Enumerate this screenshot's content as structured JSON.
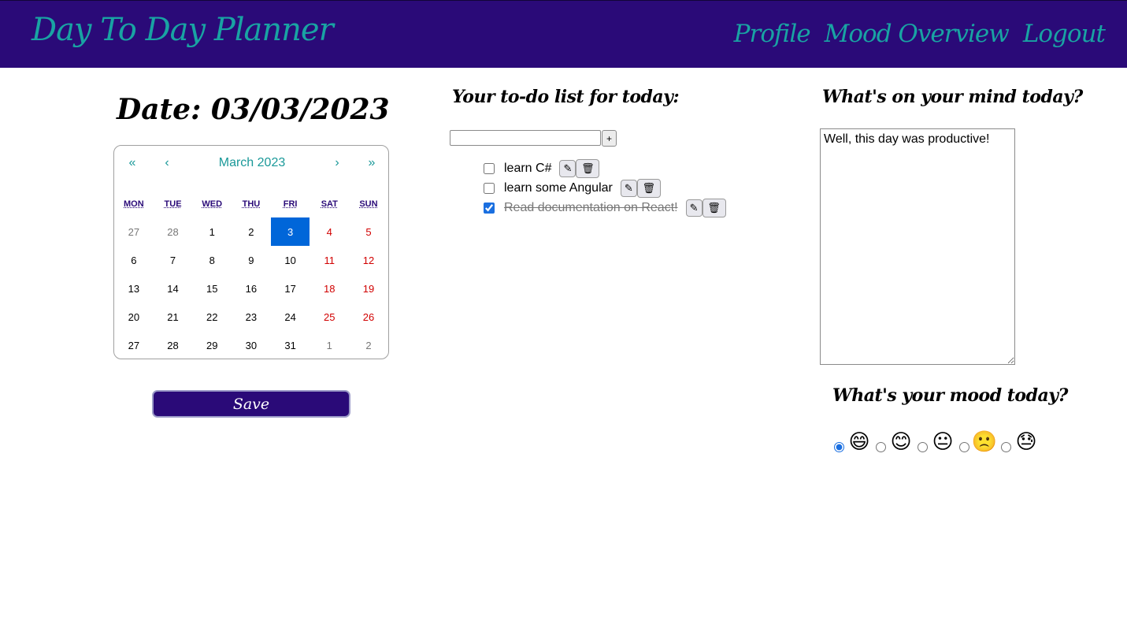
{
  "header": {
    "brand": "Day To Day Planner",
    "nav": [
      "Profile",
      "Mood Overview",
      "Logout"
    ]
  },
  "date_title": "Date: 03/03/2023",
  "calendar": {
    "month_label": "March 2023",
    "prev_year": "«",
    "prev_month": "‹",
    "next_month": "›",
    "next_year": "»",
    "weekdays": [
      "MON",
      "TUE",
      "WED",
      "THU",
      "FRI",
      "SAT",
      "SUN"
    ],
    "days": [
      {
        "d": "27",
        "type": "other"
      },
      {
        "d": "28",
        "type": "other"
      },
      {
        "d": "1",
        "type": "normal"
      },
      {
        "d": "2",
        "type": "normal"
      },
      {
        "d": "3",
        "type": "selected"
      },
      {
        "d": "4",
        "type": "weekend"
      },
      {
        "d": "5",
        "type": "weekend"
      },
      {
        "d": "6",
        "type": "normal"
      },
      {
        "d": "7",
        "type": "normal"
      },
      {
        "d": "8",
        "type": "normal"
      },
      {
        "d": "9",
        "type": "normal"
      },
      {
        "d": "10",
        "type": "normal"
      },
      {
        "d": "11",
        "type": "weekend"
      },
      {
        "d": "12",
        "type": "weekend"
      },
      {
        "d": "13",
        "type": "normal"
      },
      {
        "d": "14",
        "type": "normal"
      },
      {
        "d": "15",
        "type": "normal"
      },
      {
        "d": "16",
        "type": "normal"
      },
      {
        "d": "17",
        "type": "normal"
      },
      {
        "d": "18",
        "type": "weekend"
      },
      {
        "d": "19",
        "type": "weekend"
      },
      {
        "d": "20",
        "type": "normal"
      },
      {
        "d": "21",
        "type": "normal"
      },
      {
        "d": "22",
        "type": "normal"
      },
      {
        "d": "23",
        "type": "normal"
      },
      {
        "d": "24",
        "type": "normal"
      },
      {
        "d": "25",
        "type": "weekend"
      },
      {
        "d": "26",
        "type": "weekend"
      },
      {
        "d": "27",
        "type": "normal"
      },
      {
        "d": "28",
        "type": "normal"
      },
      {
        "d": "29",
        "type": "normal"
      },
      {
        "d": "30",
        "type": "normal"
      },
      {
        "d": "31",
        "type": "normal"
      },
      {
        "d": "1",
        "type": "other"
      },
      {
        "d": "2",
        "type": "other"
      }
    ]
  },
  "save_label": "Save",
  "todo": {
    "title": "Your to-do list for today:",
    "input_value": "",
    "add_label": "+",
    "edit_icon": "pencil-icon",
    "delete_icon": "trash-icon",
    "items": [
      {
        "text": "learn C#",
        "done": false
      },
      {
        "text": "learn some Angular",
        "done": false
      },
      {
        "text": "Read documentation on React!",
        "done": true
      }
    ]
  },
  "mind": {
    "title": "What's on your mind today?",
    "text": "Well, this day was productive!"
  },
  "mood": {
    "title": "What's your mood today?",
    "options": [
      {
        "emoji": "😄",
        "name": "grinning-face-icon",
        "checked": true
      },
      {
        "emoji": "😊",
        "name": "smiling-face-icon",
        "checked": false
      },
      {
        "emoji": "😐",
        "name": "neutral-face-icon",
        "checked": false
      },
      {
        "emoji": "🙁",
        "name": "frowning-face-icon",
        "checked": false
      },
      {
        "emoji": "😓",
        "name": "downcast-sweat-face-icon",
        "checked": false
      }
    ]
  },
  "colors": {
    "navbar": "#2a0a78",
    "brand_accent": "#19a3a3",
    "selected_day": "#0066d9",
    "weekend": "#d10000"
  }
}
